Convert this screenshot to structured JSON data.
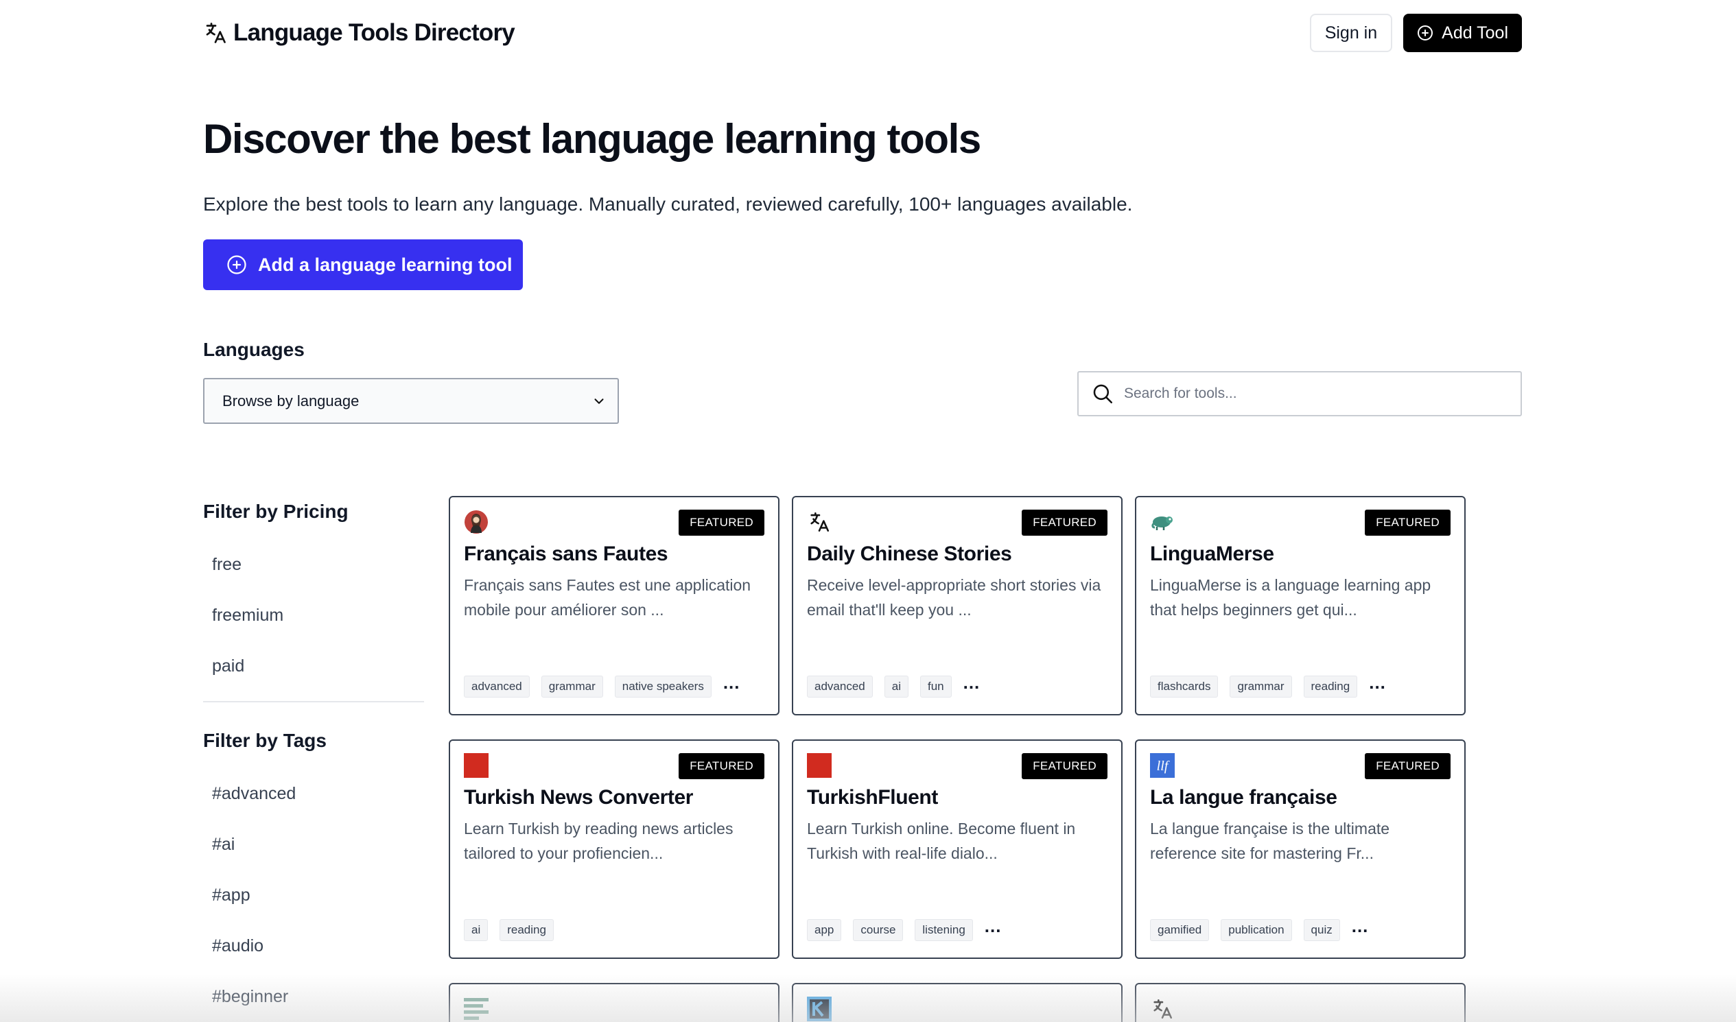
{
  "header": {
    "brand_title": "Language Tools Directory",
    "signin_label": "Sign in",
    "add_tool_label": "Add Tool"
  },
  "hero": {
    "title": "Discover the best language learning tools",
    "subtitle": "Explore the best tools to learn any language. Manually curated, reviewed carefully, 100+ languages available.",
    "cta_label": "Add a language learning tool"
  },
  "languages": {
    "label": "Languages",
    "selected": "Browse by language"
  },
  "search": {
    "placeholder": "Search for tools..."
  },
  "sidebar": {
    "pricing_title": "Filter by Pricing",
    "pricing": [
      "free",
      "freemium",
      "paid"
    ],
    "tags_title": "Filter by Tags",
    "tags": [
      "#advanced",
      "#ai",
      "#app",
      "#audio",
      "#beginner"
    ]
  },
  "cards": [
    {
      "title": "Français sans Fautes",
      "badge": "FEATURED",
      "description": "Français sans Fautes est une application mobile pour améliorer son ...",
      "tags": [
        "advanced",
        "grammar",
        "native speakers"
      ],
      "more": "...",
      "logo": "woman-portrait-icon"
    },
    {
      "title": "Daily Chinese Stories",
      "badge": "FEATURED",
      "description": "Receive level-appropriate short stories via email that'll keep you ...",
      "tags": [
        "advanced",
        "ai",
        "fun"
      ],
      "more": "...",
      "logo": "translate-icon"
    },
    {
      "title": "LinguaMerse",
      "badge": "FEATURED",
      "description": "LinguaMerse is a language learning app that helps beginners get qui...",
      "tags": [
        "flashcards",
        "grammar",
        "reading"
      ],
      "more": "...",
      "logo": "chameleon-icon"
    },
    {
      "title": "Turkish News Converter",
      "badge": "FEATURED",
      "description": "Learn Turkish by reading news articles tailored to your profiencien...",
      "tags": [
        "ai",
        "reading"
      ],
      "more": "",
      "logo": "red-square-icon"
    },
    {
      "title": "TurkishFluent",
      "badge": "FEATURED",
      "description": "Learn Turkish online. Become fluent in Turkish with real-life dialo...",
      "tags": [
        "app",
        "course",
        "listening"
      ],
      "more": "...",
      "logo": "red-square-icon"
    },
    {
      "title": "La langue française",
      "badge": "FEATURED",
      "description": "La langue française is the ultimate reference site for mastering Fr...",
      "tags": [
        "gamified",
        "publication",
        "quiz"
      ],
      "more": "...",
      "logo": "llf-icon"
    }
  ],
  "partial_cards": [
    {
      "logo": "lines-icon"
    },
    {
      "logo": "k-icon"
    },
    {
      "logo": "translate-icon"
    }
  ],
  "colors": {
    "primary": "#3730f0",
    "badge": "#000000",
    "card_border": "#374151"
  }
}
